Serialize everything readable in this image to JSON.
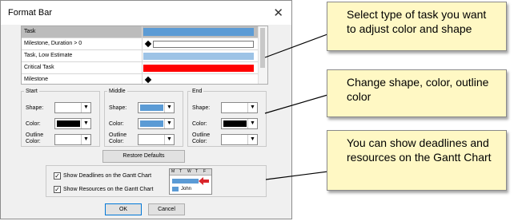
{
  "dialog": {
    "title": "Format Bar",
    "close_glyph": "✕",
    "tasks": [
      {
        "label": "Task",
        "preview": "bar",
        "color": "#5b9bd5"
      },
      {
        "label": "Milestone, Duration > 0",
        "preview": "milestone-bar",
        "color": "#ffffff"
      },
      {
        "label": "Task, Low Estimate",
        "preview": "bar",
        "color": "#9dc3e6"
      },
      {
        "label": "Critical Task",
        "preview": "bar",
        "color": "#ff0000"
      },
      {
        "label": "Milestone",
        "preview": "milestone",
        "color": "#000000"
      }
    ],
    "selected_task": "Task",
    "start": {
      "legend": "Start",
      "shape_label": "Shape:",
      "shape_value_color": "#ffffff",
      "color_label": "Color:",
      "color_value": "#000000",
      "outline_label": "Outline\nColor:",
      "outline_value": "#ffffff"
    },
    "middle": {
      "legend": "Middle",
      "shape_label": "Shape:",
      "shape_value_color": "#5b9bd5",
      "color_label": "Color:",
      "color_value": "#5b9bd5",
      "outline_label": "Outline\nColor:",
      "outline_value": "#ffffff"
    },
    "end": {
      "legend": "End",
      "shape_label": "Shape:",
      "shape_value_color": "#ffffff",
      "color_label": "Color:",
      "color_value": "#000000",
      "outline_label": "Outline\nColor:",
      "outline_value": "#ffffff"
    },
    "dropdown_glyph": "▼",
    "restore_label": "Restore Defaults",
    "show_deadlines": {
      "label": "Show Deadlines on the Gantt Chart",
      "checked": true
    },
    "show_resources": {
      "label": "Show Resources on the Gantt Chart",
      "checked": true
    },
    "check_glyph": "✓",
    "preview": {
      "days": [
        "M",
        "T",
        "W",
        "T",
        "F"
      ],
      "resource": "John",
      "arrow_color": "#d9262c"
    },
    "ok_label": "OK",
    "cancel_label": "Cancel"
  },
  "callouts": [
    {
      "text": "Select type of task you want to adjust color and shape"
    },
    {
      "text": "Change shape, color, outline color"
    },
    {
      "text": "You can show deadlines and resources on the Gantt Chart"
    }
  ]
}
